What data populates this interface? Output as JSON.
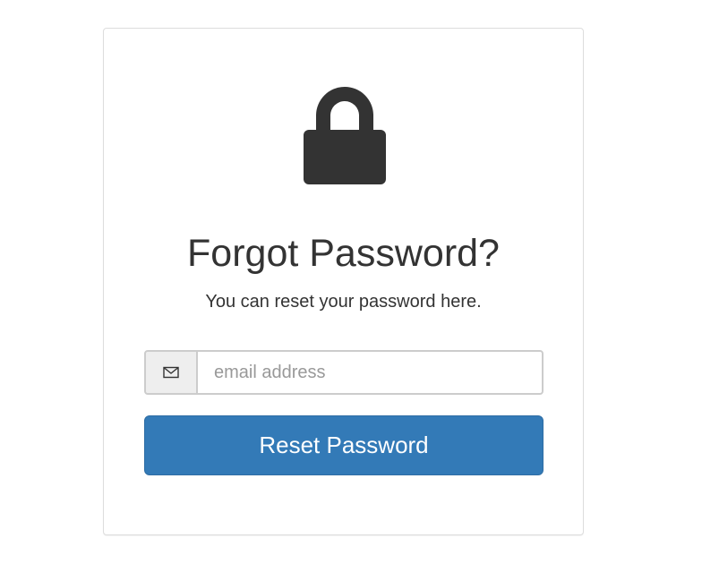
{
  "header": {
    "icon": "lock-icon",
    "title": "Forgot Password?",
    "subtitle": "You can reset your password here."
  },
  "form": {
    "email_icon": "envelope-icon",
    "email_placeholder": "email address",
    "email_value": "",
    "submit_label": "Reset Password"
  },
  "colors": {
    "primary": "#337ab7",
    "icon": "#333333",
    "text": "#333333",
    "border": "#cccccc"
  }
}
